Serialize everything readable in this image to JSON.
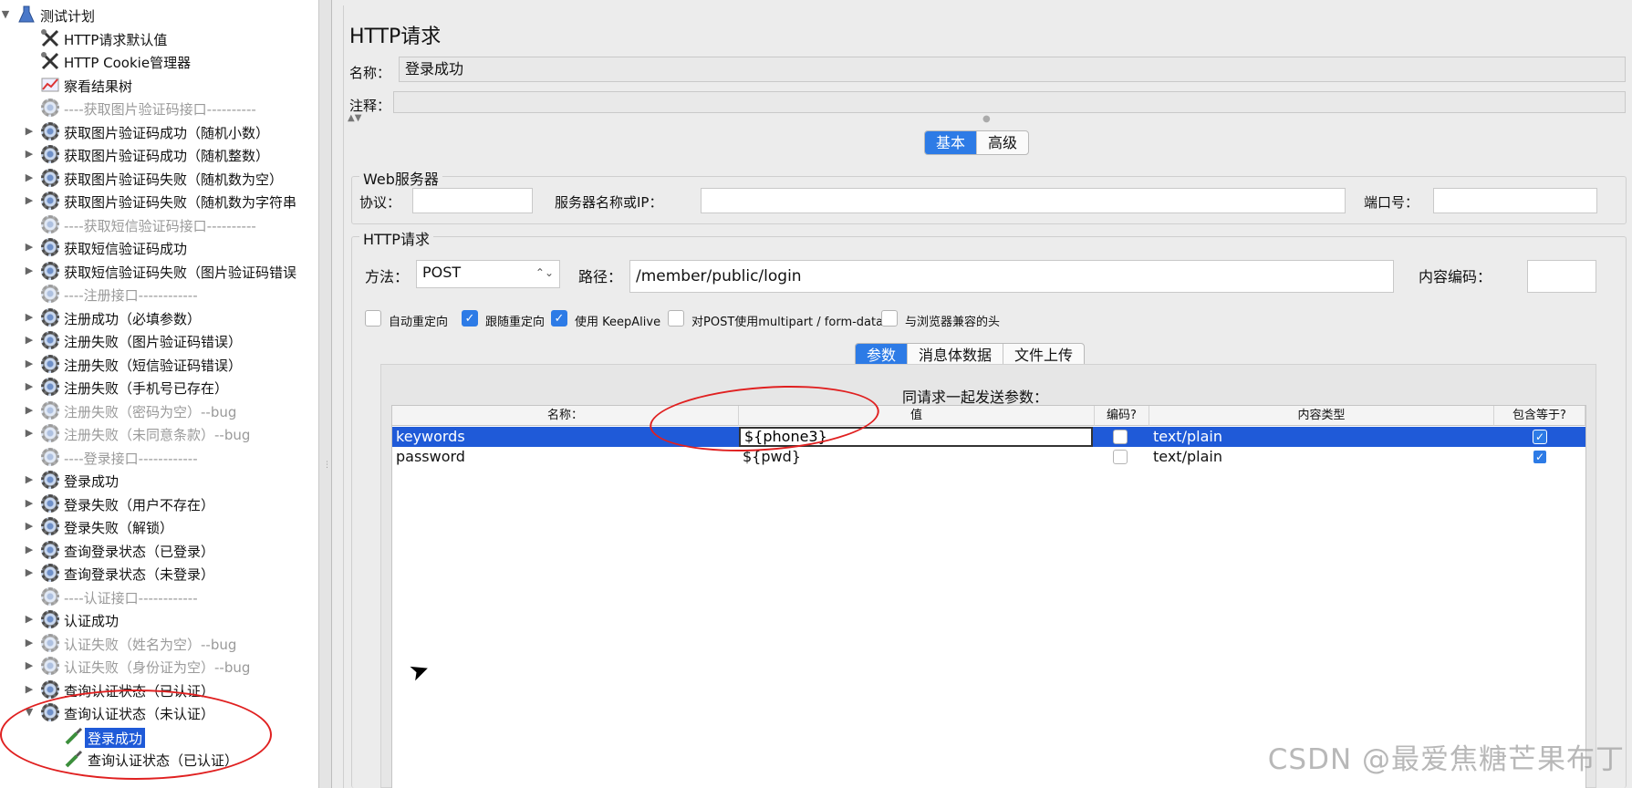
{
  "tree": {
    "items": [
      {
        "label": "测试计划",
        "icon": "beaker-icon",
        "state": "expanded",
        "disabled": false
      },
      {
        "label": "HTTP请求默认值",
        "icon": "wrench-icon",
        "state": "leaf",
        "disabled": false
      },
      {
        "label": "HTTP Cookie管理器",
        "icon": "wrench-icon",
        "state": "leaf",
        "disabled": false
      },
      {
        "label": "察看结果树",
        "icon": "chart-icon",
        "state": "leaf",
        "disabled": false
      },
      {
        "label": "----获取图片验证码接口----------",
        "icon": "gear-icon",
        "state": "leaf",
        "disabled": true
      },
      {
        "label": "获取图片验证码成功（随机小数）",
        "icon": "gear-icon",
        "state": "collapsed",
        "disabled": false
      },
      {
        "label": "获取图片验证码成功（随机整数）",
        "icon": "gear-icon",
        "state": "collapsed",
        "disabled": false
      },
      {
        "label": "获取图片验证码失败（随机数为空）",
        "icon": "gear-icon",
        "state": "collapsed",
        "disabled": false
      },
      {
        "label": "获取图片验证码失败（随机数为字符串",
        "icon": "gear-icon",
        "state": "collapsed",
        "disabled": false
      },
      {
        "label": "----获取短信验证码接口----------",
        "icon": "gear-icon",
        "state": "leaf",
        "disabled": true
      },
      {
        "label": "获取短信验证码成功",
        "icon": "gear-icon",
        "state": "collapsed",
        "disabled": false
      },
      {
        "label": "获取短信验证码失败（图片验证码错误",
        "icon": "gear-icon",
        "state": "collapsed",
        "disabled": false
      },
      {
        "label": "----注册接口------------",
        "icon": "gear-icon",
        "state": "leaf",
        "disabled": true
      },
      {
        "label": "注册成功（必填参数）",
        "icon": "gear-icon",
        "state": "collapsed",
        "disabled": false
      },
      {
        "label": "注册失败（图片验证码错误）",
        "icon": "gear-icon",
        "state": "collapsed",
        "disabled": false
      },
      {
        "label": "注册失败（短信验证码错误）",
        "icon": "gear-icon",
        "state": "collapsed",
        "disabled": false
      },
      {
        "label": "注册失败（手机号已存在）",
        "icon": "gear-icon",
        "state": "collapsed",
        "disabled": false
      },
      {
        "label": "注册失败（密码为空）--bug",
        "icon": "gear-icon",
        "state": "collapsed",
        "disabled": true
      },
      {
        "label": "注册失败（未同意条款）--bug",
        "icon": "gear-icon",
        "state": "collapsed",
        "disabled": true
      },
      {
        "label": "----登录接口------------",
        "icon": "gear-icon",
        "state": "leaf",
        "disabled": true
      },
      {
        "label": "登录成功",
        "icon": "gear-icon",
        "state": "collapsed",
        "disabled": false
      },
      {
        "label": "登录失败（用户不存在）",
        "icon": "gear-icon",
        "state": "collapsed",
        "disabled": false
      },
      {
        "label": "登录失败（解锁）",
        "icon": "gear-icon",
        "state": "collapsed",
        "disabled": false
      },
      {
        "label": "查询登录状态（已登录）",
        "icon": "gear-icon",
        "state": "collapsed",
        "disabled": false
      },
      {
        "label": "查询登录状态（未登录）",
        "icon": "gear-icon",
        "state": "collapsed",
        "disabled": false
      },
      {
        "label": "----认证接口------------",
        "icon": "gear-icon",
        "state": "leaf",
        "disabled": true
      },
      {
        "label": "认证成功",
        "icon": "gear-icon",
        "state": "collapsed",
        "disabled": false
      },
      {
        "label": "认证失败（姓名为空）--bug",
        "icon": "gear-icon",
        "state": "collapsed",
        "disabled": true
      },
      {
        "label": "认证失败（身份证为空）--bug",
        "icon": "gear-icon",
        "state": "collapsed",
        "disabled": true
      },
      {
        "label": "查询认证状态（已认证）",
        "icon": "gear-icon",
        "state": "collapsed",
        "disabled": false
      },
      {
        "label": "查询认证状态（未认证）",
        "icon": "gear-icon",
        "state": "expanded",
        "disabled": false
      },
      {
        "label": "登录成功",
        "icon": "pipette-icon",
        "state": "child",
        "disabled": false,
        "selected": true
      },
      {
        "label": "查询认证状态（已认证）",
        "icon": "pipette-icon",
        "state": "child",
        "disabled": false
      }
    ]
  },
  "header": {
    "title": "HTTP请求",
    "name_label": "名称：",
    "name_value": "登录成功",
    "comment_label": "注释："
  },
  "tabs": {
    "basic": "基本",
    "advanced": "高级",
    "active": "basic"
  },
  "web_server": {
    "title": "Web服务器",
    "protocol_label": "协议：",
    "protocol_value": "",
    "server_label": "服务器名称或IP：",
    "server_value": "",
    "port_label": "端口号：",
    "port_value": ""
  },
  "http_request": {
    "title": "HTTP请求",
    "method_label": "方法：",
    "method_value": "POST",
    "path_label": "路径：",
    "path_value": "/member/public/login",
    "encoding_label": "内容编码：",
    "encoding_value": "",
    "options": [
      {
        "label": "自动重定向",
        "checked": false
      },
      {
        "label": "跟随重定向",
        "checked": true
      },
      {
        "label": "使用 KeepAlive",
        "checked": true
      },
      {
        "label": "对POST使用multipart / form-data",
        "checked": false
      },
      {
        "label": "与浏览器兼容的头",
        "checked": false
      }
    ]
  },
  "subtabs": {
    "params": "参数",
    "body": "消息体数据",
    "files": "文件上传",
    "active": "params"
  },
  "params_table": {
    "caption": "同请求一起发送参数：",
    "columns": [
      "名称：",
      "值",
      "编码?",
      "内容类型",
      "包含等于?"
    ],
    "rows": [
      {
        "name": "keywords",
        "value": "${phone3}",
        "encode": false,
        "content_type": "text/plain",
        "include_equals": true,
        "selected": true
      },
      {
        "name": "password",
        "value": "${pwd}",
        "encode": false,
        "content_type": "text/plain",
        "include_equals": true,
        "selected": false
      }
    ]
  },
  "watermark": "CSDN @最爱焦糖芒果布丁",
  "colors": {
    "selection": "#1f5ad8",
    "accent": "#2d7be6",
    "annotation": "#e02020"
  }
}
